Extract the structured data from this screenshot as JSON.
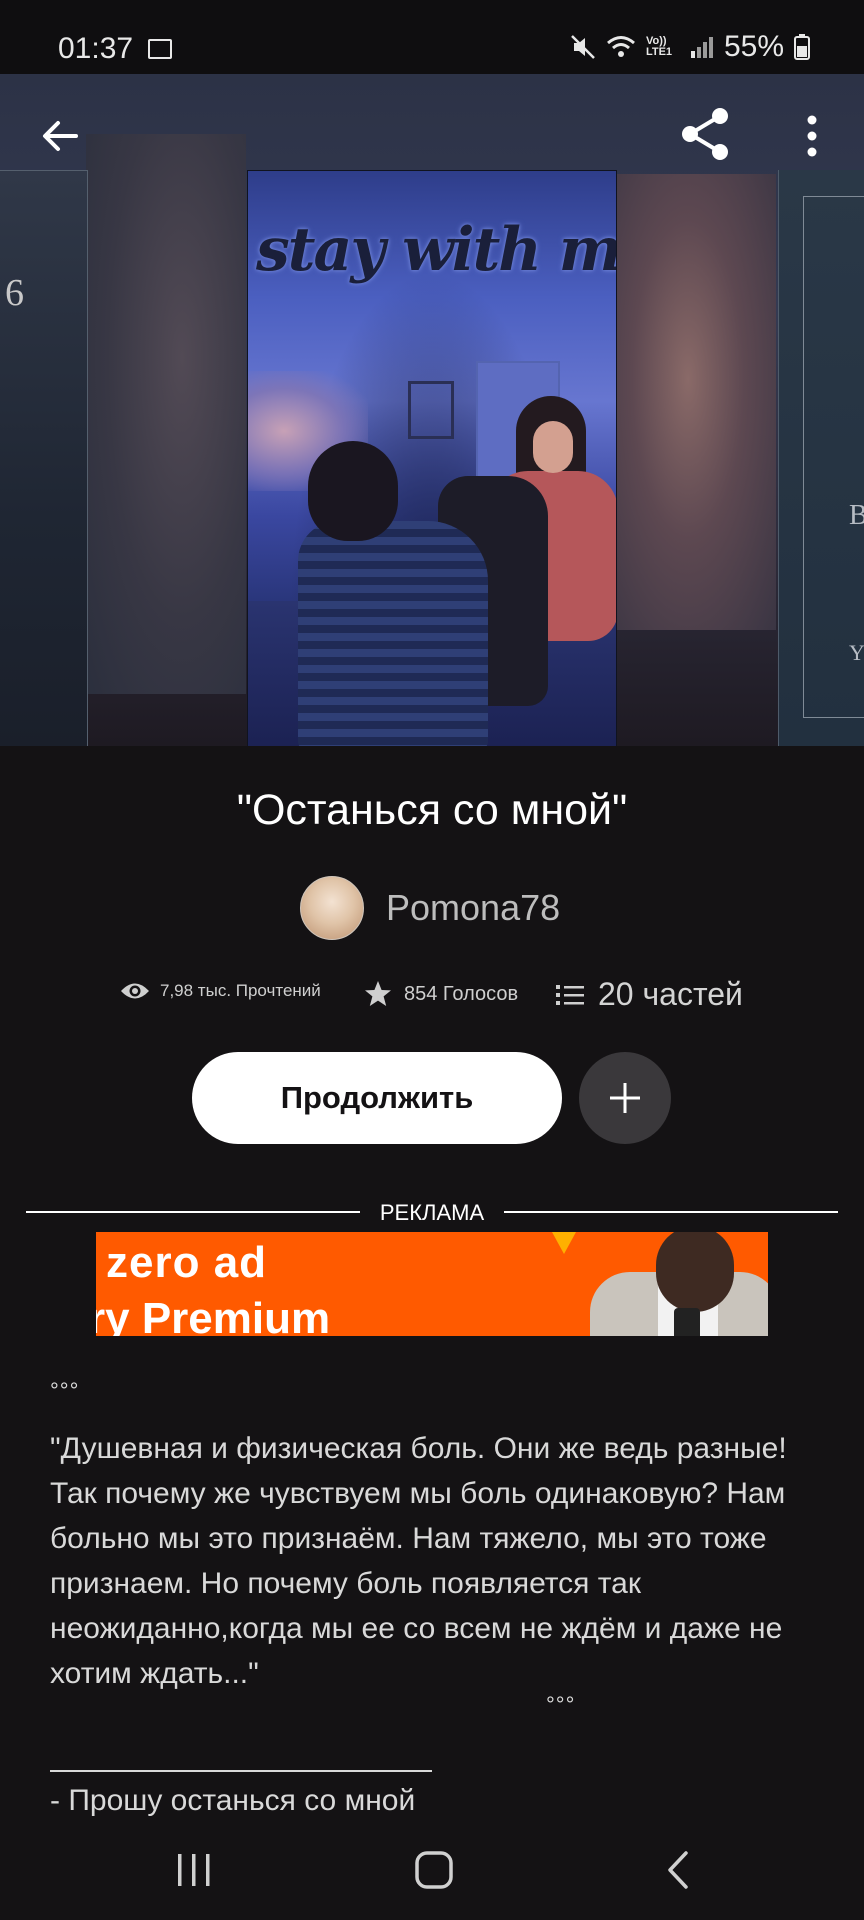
{
  "status_bar": {
    "time": "01:37",
    "network_label": "Vo)) LTE1",
    "battery": "55%"
  },
  "hero": {
    "left_cover_number": "6",
    "right_cover_letter_b": "B",
    "right_cover_letter_y": "Y",
    "cover_title": "stay with me"
  },
  "story": {
    "title": "\"Останься со мной\"",
    "author": "Pomona78",
    "reads": "7,98 тыс. Прочтений",
    "votes": "854 Голосов",
    "parts": "20 частей",
    "continue_label": "Продолжить"
  },
  "ad": {
    "label": "РЕКЛАМА",
    "line1": "zero ad",
    "line2": "ry Premium"
  },
  "description": {
    "dots_top": "°°°",
    "text": "\"Душевная и физическая боль. Они же ведь разные! Так почему же чувствуем мы боль одинаковую? Нам больно мы это признаём. Нам тяжело, мы это тоже признаем. Но почему боль появляется так неожиданно,когда мы ее со всем не ждём и даже не хотим ждать...\"",
    "dots_bottom": "°°°",
    "quote": "- Прошу останься со мной"
  },
  "colors": {
    "background": "#141214",
    "continue_button": "#ffffff",
    "add_button": "#3a383b",
    "ad_banner": "#ff5a00"
  },
  "icons": [
    "back-arrow-icon",
    "share-icon",
    "more-vert-icon",
    "eye-icon",
    "star-icon",
    "list-icon",
    "plus-icon",
    "recent-apps-icon",
    "home-icon",
    "nav-back-icon"
  ]
}
